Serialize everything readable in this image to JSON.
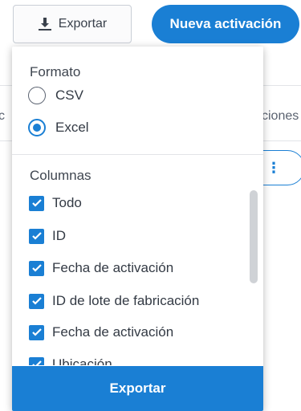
{
  "toolbar": {
    "export_label": "Exportar",
    "new_activation_label": "Nueva activación"
  },
  "background": {
    "col_left_fragment": "c",
    "col_right_fragment": "ciones"
  },
  "export_menu": {
    "format_title": "Formato",
    "formats": [
      {
        "label": "CSV",
        "selected": false
      },
      {
        "label": "Excel",
        "selected": true
      }
    ],
    "columns_title": "Columnas",
    "columns": [
      {
        "label": "Todo",
        "checked": true
      },
      {
        "label": "ID",
        "checked": true
      },
      {
        "label": "Fecha de activación",
        "checked": true
      },
      {
        "label": "ID de lote de fabricación",
        "checked": true
      },
      {
        "label": "Fecha de activación",
        "checked": true
      },
      {
        "label": "Ubicación",
        "checked": true
      }
    ],
    "submit_label": "Exportar"
  },
  "colors": {
    "accent": "#1a7fd4"
  }
}
